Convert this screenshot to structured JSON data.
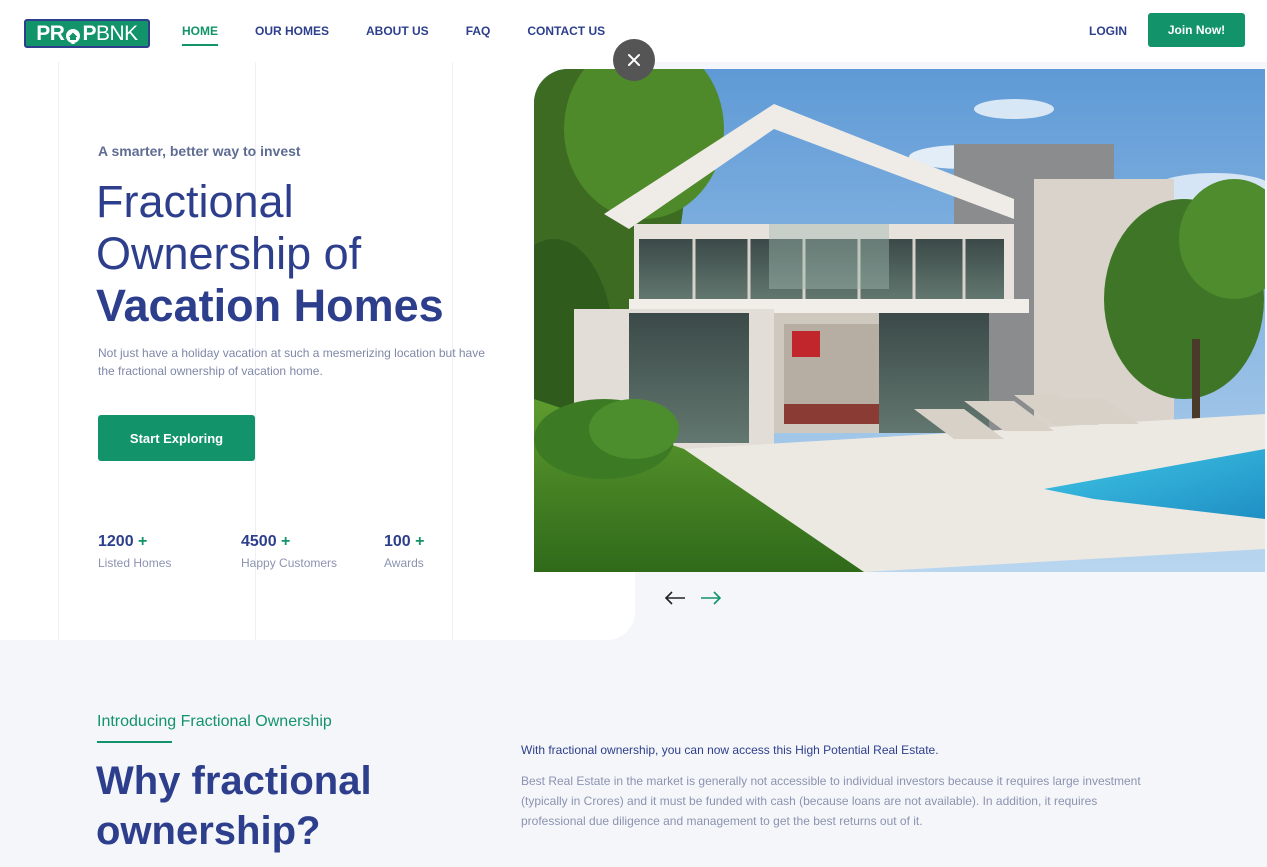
{
  "header": {
    "logo": {
      "part1": "PR",
      "part2": "P",
      "part3": "BNK"
    },
    "nav": [
      {
        "label": "HOME",
        "active": true
      },
      {
        "label": "OUR HOMES",
        "active": false
      },
      {
        "label": "ABOUT US",
        "active": false
      },
      {
        "label": "FAQ",
        "active": false
      },
      {
        "label": "CONTACT US",
        "active": false
      }
    ],
    "login_label": "LOGIN",
    "join_label": "Join Now!"
  },
  "hero": {
    "kicker": "A smarter, better way to invest",
    "title_line1": "Fractional",
    "title_line2": "Ownership of",
    "title_bold": "Vacation Homes",
    "description": "Not just have a holiday vacation at such a mesmerizing location but have the fractional ownership of vacation home.",
    "cta_label": "Start Exploring",
    "stats": [
      {
        "value": "1200",
        "plus": "+",
        "label": "Listed Homes"
      },
      {
        "value": "4500",
        "plus": "+",
        "label": "Happy Customers"
      },
      {
        "value": "100",
        "plus": "+",
        "label": "Awards"
      }
    ]
  },
  "intro": {
    "kicker": "Introducing Fractional Ownership",
    "heading": "Why fractional ownership?",
    "lead": "With fractional ownership, you can now access this High Potential Real Estate.",
    "body": "Best Real Estate in the market is generally not accessible to individual investors because it requires large investment (typically in Crores) and it must be funded with cash (because loans are not available). In addition, it requires professional due diligence and management to get the best returns out of it."
  },
  "icons": {
    "close": "close-icon",
    "prev": "arrow-left-icon",
    "next": "arrow-right-icon",
    "logo_pin": "house-pin-icon"
  },
  "colors": {
    "brand_green": "#12936a",
    "brand_navy": "#2d3f8c",
    "text_muted": "#8b93b0",
    "background": "#f5f6fa"
  }
}
